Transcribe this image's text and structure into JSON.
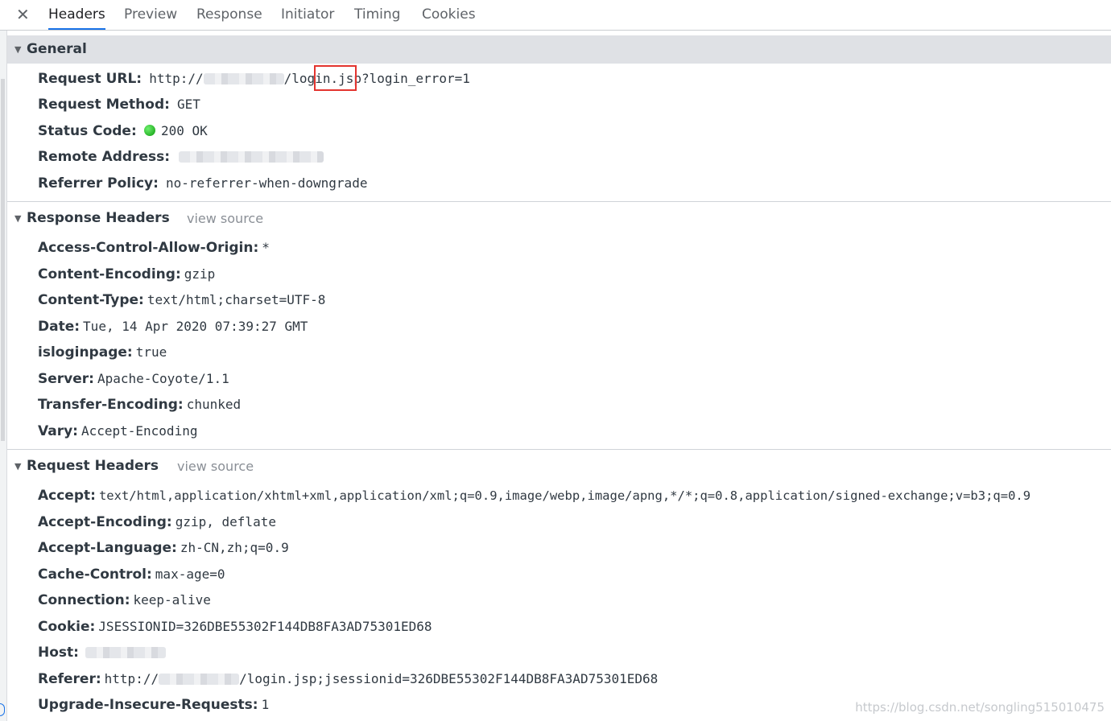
{
  "tabs": [
    "Headers",
    "Preview",
    "Response",
    "Initiator",
    "Timing",
    "Cookies"
  ],
  "close_glyph": "✕",
  "general": {
    "title": "General",
    "rows": [
      {
        "key": "Request URL:",
        "pre": "http://",
        "post": "/login.jsp?login_error=1"
      },
      {
        "key": "Request Method:",
        "value": "GET"
      },
      {
        "key": "Status Code:",
        "value": "200 OK"
      },
      {
        "key": "Remote Address:",
        "value": ""
      },
      {
        "key": "Referrer Policy:",
        "value": "no-referrer-when-downgrade"
      }
    ]
  },
  "response_headers": {
    "title": "Response Headers",
    "view_source": "view source",
    "rows": [
      {
        "key": "Access-Control-Allow-Origin:",
        "value": "*"
      },
      {
        "key": "Content-Encoding:",
        "value": "gzip"
      },
      {
        "key": "Content-Type:",
        "value": "text/html;charset=UTF-8"
      },
      {
        "key": "Date:",
        "value": "Tue, 14 Apr 2020 07:39:27 GMT"
      },
      {
        "key": "isloginpage:",
        "value": "true"
      },
      {
        "key": "Server:",
        "value": "Apache-Coyote/1.1"
      },
      {
        "key": "Transfer-Encoding:",
        "value": "chunked"
      },
      {
        "key": "Vary:",
        "value": "Accept-Encoding"
      }
    ]
  },
  "request_headers": {
    "title": "Request Headers",
    "view_source": "view source",
    "rows": [
      {
        "key": "Accept:",
        "value": "text/html,application/xhtml+xml,application/xml;q=0.9,image/webp,image/apng,*/*;q=0.8,application/signed-exchange;v=b3;q=0.9"
      },
      {
        "key": "Accept-Encoding:",
        "value": "gzip, deflate"
      },
      {
        "key": "Accept-Language:",
        "value": "zh-CN,zh;q=0.9"
      },
      {
        "key": "Cache-Control:",
        "value": "max-age=0"
      },
      {
        "key": "Connection:",
        "value": "keep-alive"
      },
      {
        "key": "Cookie:",
        "value": "JSESSIONID=326DBE55302F144DB8FA3AD75301ED68"
      },
      {
        "key": "Host:",
        "value": ""
      },
      {
        "key": "Referer:",
        "pre": "http://",
        "post": "/login.jsp;jsessionid=326DBE55302F144DB8FA3AD75301ED68"
      },
      {
        "key": "Upgrade-Insecure-Requests:",
        "value": "1"
      }
    ]
  },
  "watermark": "https://blog.csdn.net/songling515010475",
  "colors": {
    "accent": "#1a73e8",
    "highlight": "#e3342f",
    "status_ok": "#14b514"
  }
}
